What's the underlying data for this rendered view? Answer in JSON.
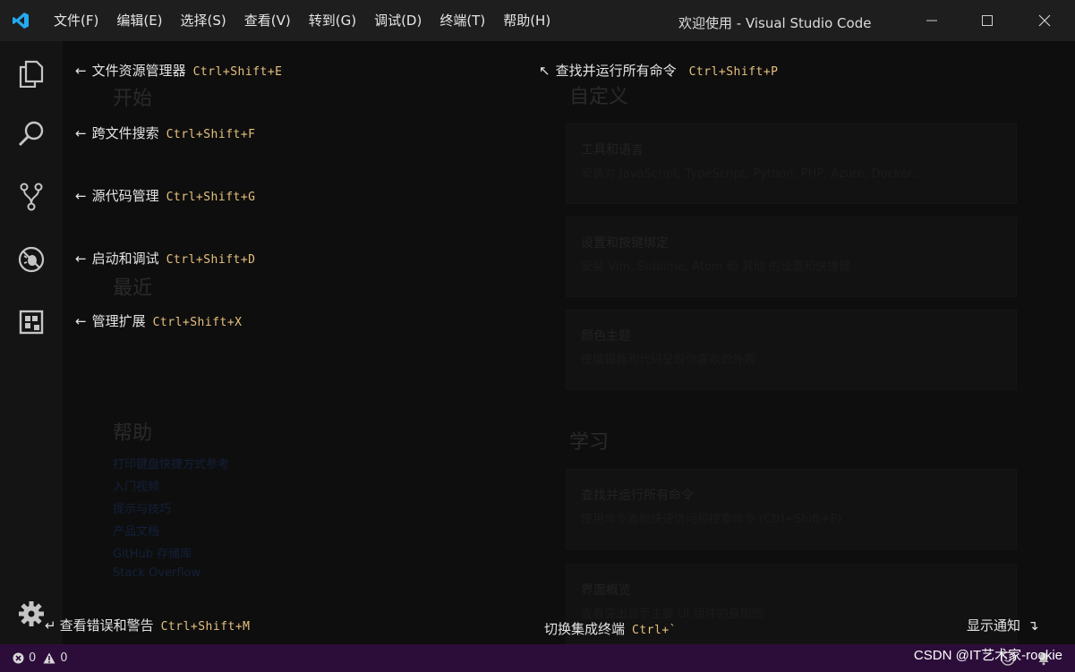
{
  "titlebar": {
    "menu": [
      "文件(F)",
      "编辑(E)",
      "选择(S)",
      "查看(V)",
      "转到(G)",
      "调试(D)",
      "终端(T)",
      "帮助(H)"
    ],
    "window_title": "欢迎使用 - Visual Studio Code"
  },
  "hints": {
    "explorer": {
      "label": "文件资源管理器",
      "key": "Ctrl+Shift+E"
    },
    "search": {
      "label": "跨文件搜索",
      "key": "Ctrl+Shift+F"
    },
    "scm": {
      "label": "源代码管理",
      "key": "Ctrl+Shift+G"
    },
    "debug": {
      "label": "启动和调试",
      "key": "Ctrl+Shift+D"
    },
    "extensions": {
      "label": "管理扩展",
      "key": "Ctrl+Shift+X"
    },
    "command_palette": {
      "label": "查找并运行所有命令",
      "key": "Ctrl+Shift+P"
    },
    "problems": {
      "label": "查看错误和警告",
      "key": "Ctrl+Shift+M"
    },
    "terminal": {
      "label": "切换集成终端",
      "key": "Ctrl+`"
    },
    "notifications": {
      "label": "显示通知"
    }
  },
  "background": {
    "start_title": "开始",
    "recent_title": "最近",
    "help_title": "帮助",
    "learn_title": "学习",
    "customize_title": "自定义",
    "help_links": [
      "打印键盘快捷方式参考",
      "入门视频",
      "提示与技巧",
      "产品文档",
      "GitHub 存储库",
      "Stack Overflow"
    ],
    "cards": [
      {
        "title": "工具和语言",
        "desc": "安装对 JavaScript, TypeScript, Python, PHP, Azure, Docker..."
      },
      {
        "title": "设置和按键绑定",
        "desc": "安装 Vim, Sublime, Atom 和 其他 的设置和快捷键"
      },
      {
        "title": "颜色主题",
        "desc": "使编辑器和代码呈现你喜欢的外观"
      },
      {
        "title": "查找并运行所有命令",
        "desc": "使用命令面板快速访问和搜索命令 (Ctrl+Shift+P)"
      },
      {
        "title": "界面概览",
        "desc": "查看突出显示主要 UI 组件的叠加图"
      }
    ]
  },
  "statusbar": {
    "errors": "0",
    "warnings": "0",
    "watermark": "CSDN @IT艺术家-rookie"
  },
  "colors": {
    "accent_key": "#e6c17d",
    "statusbar_bg": "#2c0d3a",
    "vscode_blue": "#23a9f2"
  }
}
